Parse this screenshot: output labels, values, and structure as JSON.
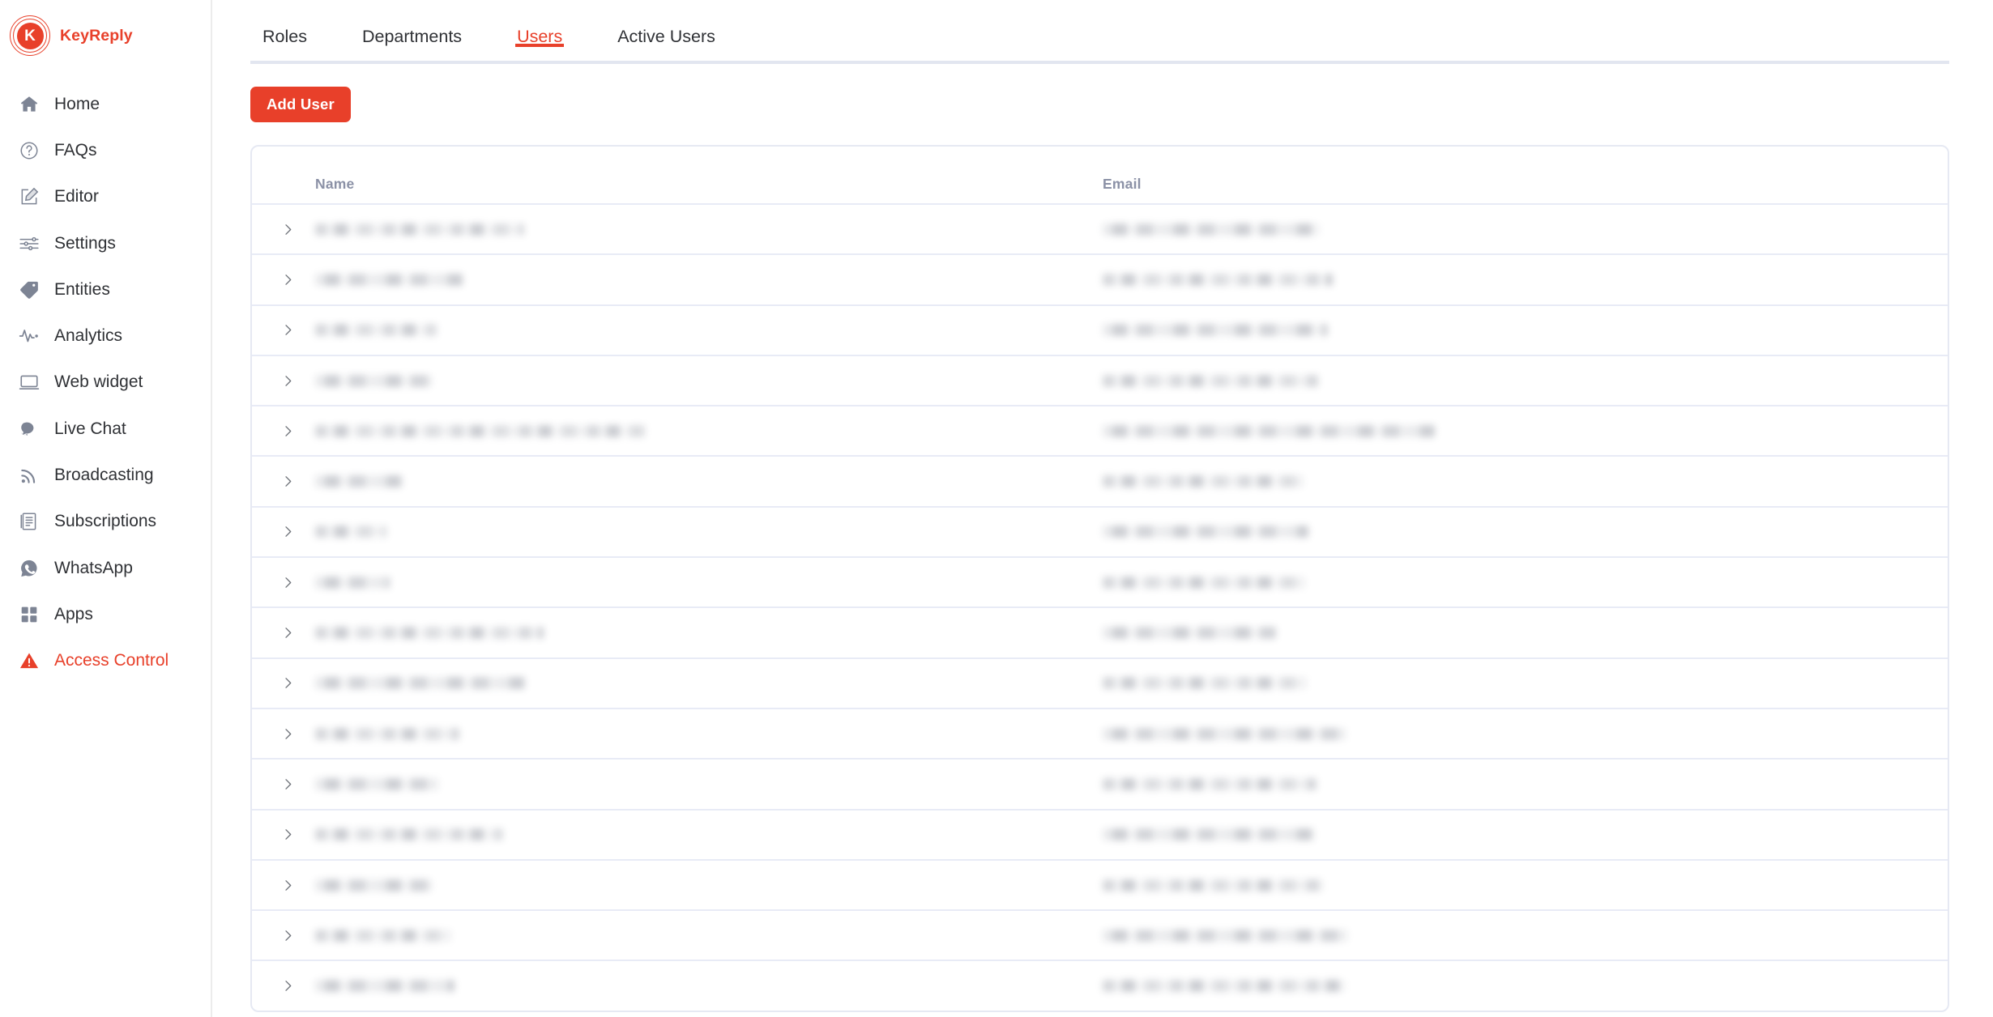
{
  "brand": {
    "name": "KeyReply",
    "mark_letter": "K",
    "color": "#e8402a"
  },
  "sidebar": {
    "items": [
      {
        "label": "Home",
        "icon": "home-icon",
        "active": false
      },
      {
        "label": "FAQs",
        "icon": "question-circle-icon",
        "active": false
      },
      {
        "label": "Editor",
        "icon": "pencil-square-icon",
        "active": false
      },
      {
        "label": "Settings",
        "icon": "sliders-icon",
        "active": false
      },
      {
        "label": "Entities",
        "icon": "tag-icon",
        "active": false
      },
      {
        "label": "Analytics",
        "icon": "pulse-icon",
        "active": false
      },
      {
        "label": "Web widget",
        "icon": "monitor-icon",
        "active": false
      },
      {
        "label": "Live Chat",
        "icon": "chat-bubbles-icon",
        "active": false
      },
      {
        "label": "Broadcasting",
        "icon": "broadcast-icon",
        "active": false
      },
      {
        "label": "Subscriptions",
        "icon": "document-list-icon",
        "active": false
      },
      {
        "label": "WhatsApp",
        "icon": "whatsapp-icon",
        "active": false
      },
      {
        "label": "Apps",
        "icon": "grid-apps-icon",
        "active": false
      },
      {
        "label": "Access Control",
        "icon": "warning-triangle-icon",
        "active": true
      }
    ]
  },
  "tabs": [
    {
      "label": "Roles",
      "active": false
    },
    {
      "label": "Departments",
      "active": false
    },
    {
      "label": "Users",
      "active": true
    },
    {
      "label": "Active Users",
      "active": false
    }
  ],
  "toolbar": {
    "add_user_label": "Add User"
  },
  "table": {
    "columns": [
      "Name",
      "Email"
    ],
    "rows": [
      {
        "name": "",
        "email": "",
        "name_w": 258,
        "email_w": 268,
        "redacted": true
      },
      {
        "name": "",
        "email": "",
        "name_w": 182,
        "email_w": 284,
        "redacted": true
      },
      {
        "name": "",
        "email": "",
        "name_w": 150,
        "email_w": 278,
        "redacted": true
      },
      {
        "name": "",
        "email": "",
        "name_w": 144,
        "email_w": 266,
        "redacted": true
      },
      {
        "name": "",
        "email": "",
        "name_w": 408,
        "email_w": 410,
        "redacted": true
      },
      {
        "name": "",
        "email": "",
        "name_w": 108,
        "email_w": 248,
        "redacted": true
      },
      {
        "name": "",
        "email": "",
        "name_w": 88,
        "email_w": 254,
        "redacted": true
      },
      {
        "name": "",
        "email": "",
        "name_w": 92,
        "email_w": 250,
        "redacted": true
      },
      {
        "name": "",
        "email": "",
        "name_w": 282,
        "email_w": 214,
        "redacted": true
      },
      {
        "name": "",
        "email": "",
        "name_w": 260,
        "email_w": 252,
        "redacted": true
      },
      {
        "name": "",
        "email": "",
        "name_w": 178,
        "email_w": 300,
        "redacted": true
      },
      {
        "name": "",
        "email": "",
        "name_w": 152,
        "email_w": 264,
        "redacted": true
      },
      {
        "name": "",
        "email": "",
        "name_w": 232,
        "email_w": 262,
        "redacted": true
      },
      {
        "name": "",
        "email": "",
        "name_w": 144,
        "email_w": 272,
        "redacted": true
      },
      {
        "name": "",
        "email": "",
        "name_w": 168,
        "email_w": 302,
        "redacted": true
      },
      {
        "name": "",
        "email": "",
        "name_w": 172,
        "email_w": 300,
        "redacted": true
      }
    ]
  }
}
